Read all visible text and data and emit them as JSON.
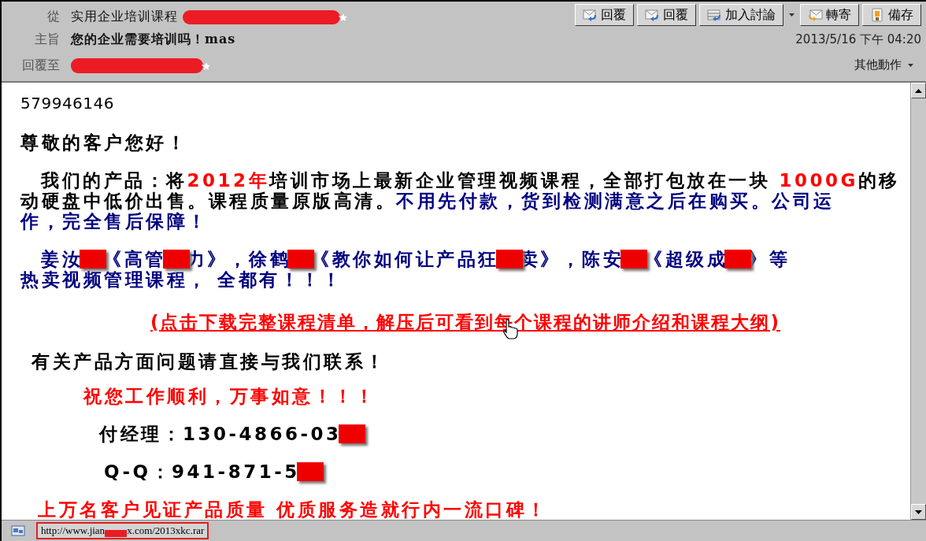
{
  "header": {
    "from": {
      "label": "從",
      "name": "实用企业培训课程",
      "redacted": true
    },
    "subject": {
      "label": "主旨",
      "text": "您的企业需要培训吗！mas"
    },
    "reply_to": {
      "label": "回覆至",
      "redacted": true
    },
    "toolbar": [
      {
        "label": "回覆",
        "kind": "reply"
      },
      {
        "label": "回覆",
        "kind": "reply"
      },
      {
        "label": "加入討論",
        "kind": "discuss"
      },
      {
        "label": "轉寄",
        "kind": "forward"
      },
      {
        "label": "備存",
        "kind": "save"
      }
    ],
    "date": "2013/5/16 下午 04:20",
    "more_actions": "其他動作"
  },
  "body": [
    {
      "kind": "plain",
      "lines": [
        [
          {
            "kind": "text",
            "text": "579946146",
            "color": "#000000"
          }
        ]
      ]
    },
    {
      "kind": "bold",
      "lines": [
        [
          {
            "kind": "text",
            "text": "尊敬的客户您好！",
            "color": "#000000"
          }
        ]
      ]
    },
    {
      "kind": "bold",
      "lines": [
        [
          {
            "kind": "text",
            "text": "我们的产品：将",
            "color": "#000000"
          },
          {
            "kind": "text",
            "text": "2012年",
            "color": "#ff0000"
          },
          {
            "kind": "text",
            "text": "培训市场上最新企业管理视频课程，全部打包放在一块 ",
            "color": "#000000"
          },
          {
            "kind": "text",
            "text": "1000G",
            "color": "#ff0000"
          },
          {
            "kind": "text",
            "text": "的移",
            "color": "#000000"
          }
        ],
        [
          {
            "kind": "text",
            "text": "动硬盘中低价出售。课程质量原版高清。",
            "color": "#000000"
          },
          {
            "kind": "text",
            "text": "不用先付款，货到检测满意之后在购买。公司运",
            "color": "#000080"
          }
        ],
        [
          {
            "kind": "text",
            "text": "作，完全售后保障！",
            "color": "#000080"
          }
        ]
      ]
    },
    {
      "kind": "bold",
      "lines": [
        [
          {
            "kind": "text",
            "text": "姜汝",
            "color": "#000080"
          },
          {
            "kind": "redaction"
          },
          {
            "kind": "text",
            "text": "《高管",
            "color": "#000080"
          },
          {
            "kind": "redaction"
          },
          {
            "kind": "text",
            "text": "力》，徐鹤",
            "color": "#000080"
          },
          {
            "kind": "redaction"
          },
          {
            "kind": "text",
            "text": "《教你如何让产品狂",
            "color": "#000080"
          },
          {
            "kind": "redaction"
          },
          {
            "kind": "text",
            "text": "卖》，陈安",
            "color": "#000080"
          },
          {
            "kind": "redaction"
          },
          {
            "kind": "text",
            "text": "《超级成",
            "color": "#000080"
          },
          {
            "kind": "redaction"
          },
          {
            "kind": "text",
            "text": "》等",
            "color": "#000080"
          }
        ],
        [
          {
            "kind": "text",
            "text": "热卖视频管理课程， 全都有！！！",
            "color": "#000080"
          }
        ]
      ]
    },
    {
      "kind": "link",
      "lines": [
        [
          {
            "kind": "text",
            "text": "(点击下载完整课程清单，解压后可看到每个课程的讲师介绍和课程大纲)",
            "color": "#ff0000"
          }
        ]
      ]
    },
    {
      "kind": "bold",
      "lines": [
        [
          {
            "kind": "text",
            "text": "有关产品方面问题请直接与我们联系！",
            "color": "#000000"
          }
        ]
      ]
    },
    {
      "kind": "bold",
      "lines": [
        [
          {
            "kind": "text",
            "text": "祝您工作顺利，万事如意！！！",
            "color": "#ff0000"
          }
        ]
      ]
    },
    {
      "kind": "bold",
      "lines": [
        [
          {
            "kind": "text",
            "text": "付经理：130-4866-03",
            "color": "#000000"
          },
          {
            "kind": "redaction"
          }
        ]
      ]
    },
    {
      "kind": "bold",
      "lines": [
        [
          {
            "kind": "text",
            "text": "Q-Q：941-871-5",
            "color": "#000000"
          },
          {
            "kind": "redaction"
          }
        ]
      ]
    },
    {
      "kind": "bold",
      "lines": [
        [
          {
            "kind": "text",
            "text": "上万名客户见证产品质量  优质服务造就行内一流口碑！",
            "color": "#ff0000"
          }
        ]
      ]
    }
  ],
  "status_bar": {
    "url_parts": [
      {
        "kind": "text",
        "text": "http://www.jian"
      },
      {
        "kind": "redaction"
      },
      {
        "kind": "text",
        "text": "x.com/2013xkc.rar"
      }
    ]
  }
}
